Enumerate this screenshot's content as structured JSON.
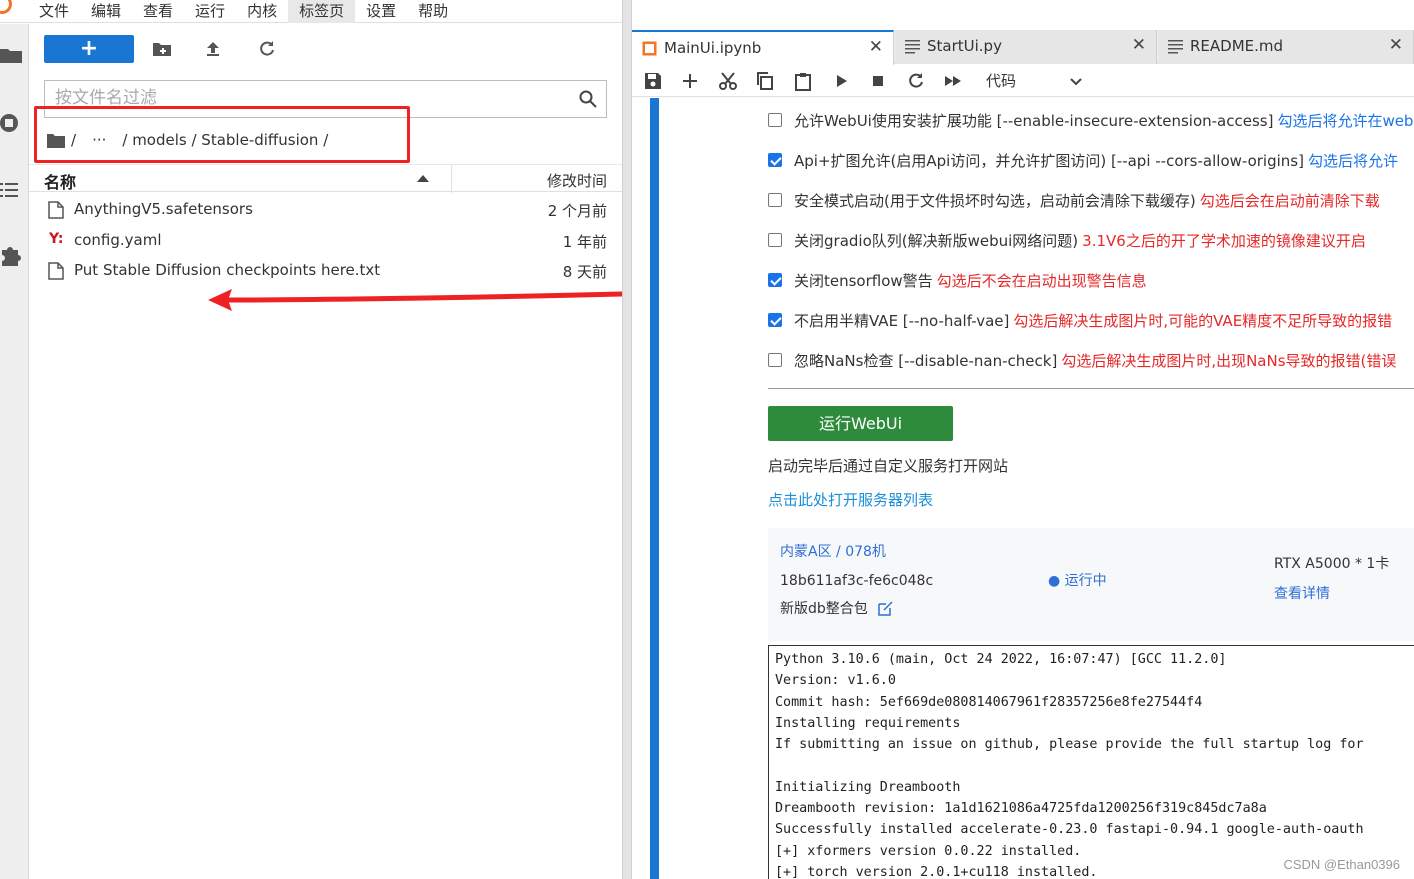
{
  "menubar": {
    "items": [
      {
        "label": "文件"
      },
      {
        "label": "编辑"
      },
      {
        "label": "查看"
      },
      {
        "label": "运行"
      },
      {
        "label": "内核"
      },
      {
        "label": "标签页"
      },
      {
        "label": "设置"
      },
      {
        "label": "帮助"
      }
    ]
  },
  "filebrowser": {
    "new_label": "+",
    "filter_placeholder": "按文件名过滤",
    "breadcrumb": {
      "root": "/",
      "ellipsis": "···",
      "path": "/ models / Stable-diffusion /"
    },
    "header": {
      "name": "名称",
      "modified": "修改时间"
    },
    "files": [
      {
        "name": "AnythingV5.safetensors",
        "modified": "2 个月前",
        "icon": "file-icon"
      },
      {
        "name": "config.yaml",
        "modified": "1 年前",
        "icon": "yaml-icon",
        "icon_text": "Y:"
      },
      {
        "name": "Put Stable Diffusion checkpoints here.txt",
        "modified": "8 天前",
        "icon": "file-icon"
      }
    ]
  },
  "tabs": [
    {
      "label": "MainUi.ipynb",
      "close": "✕",
      "icon": "notebook-icon"
    },
    {
      "label": "StartUi.py",
      "close": "✕",
      "icon": "text-file-icon"
    },
    {
      "label": "README.md",
      "close": "✕",
      "icon": "text-file-icon"
    }
  ],
  "nb_toolbar": {
    "cell_type": "代码"
  },
  "options": [
    {
      "checked": false,
      "text": "允许WebUi使用安装扩展功能 [--enable-insecure-extension-access]",
      "note": "勾选后将允许在web",
      "note_color": "blue"
    },
    {
      "checked": true,
      "text": "Api+扩图允许(启用Api访问，并允许扩图访问) [--api --cors-allow-origins]",
      "note": "勾选后将允许",
      "note_color": "blue"
    },
    {
      "checked": false,
      "text": "安全模式启动(用于文件损坏时勾选，启动前会清除下载缓存)",
      "note": "勾选后会在启动前清除下载",
      "note_color": "red"
    },
    {
      "checked": false,
      "text": "关闭gradio队列(解决新版webui网络问题)",
      "note": "3.1V6之后的开了学术加速的镜像建议开启",
      "note_color": "red"
    },
    {
      "checked": true,
      "text": "关闭tensorflow警告",
      "note": "勾选后不会在启动出现警告信息",
      "note_color": "red"
    },
    {
      "checked": true,
      "text": "不启用半精VAE [--no-half-vae]",
      "note": "勾选后解决生成图片时,可能的VAE精度不足所导致的报错",
      "note_color": "red"
    },
    {
      "checked": false,
      "text": "忽略NaNs检查 [--disable-nan-check]",
      "note": "勾选后解决生成图片时,出现NaNs导致的报错(错误",
      "note_color": "red"
    }
  ],
  "run_button": "运行WebUi",
  "after_run_text": "启动完毕后通过自定义服务打开网站",
  "server_list_link": "点击此处打开服务器列表",
  "server_card": {
    "region": "内蒙A区 / 078机",
    "instance_id": "18b611af3c-fe6c048c",
    "package": "新版db整合包",
    "status": "● 运行中",
    "gpu": "RTX A5000 * 1卡",
    "detail_link": "查看详情"
  },
  "console_lines": [
    "Python 3.10.6 (main, Oct 24 2022, 16:07:47) [GCC 11.2.0]",
    "Version: v1.6.0",
    "Commit hash: 5ef669de080814067961f28357256e8fe27544f4",
    "Installing requirements",
    "If submitting an issue on github, please provide the full startup log for",
    "",
    "Initializing Dreambooth",
    "Dreambooth revision: 1a1d1621086a4725fda1200256f319c845dc7a8a",
    "Successfully installed accelerate-0.23.0 fastapi-0.94.1 google-auth-oauth",
    "[+] xformers version 0.0.22 installed.",
    "[+] torch version 2.0.1+cu118 installed."
  ],
  "watermark": "CSDN @Ethan0396",
  "colors": {
    "accent": "#1976d2",
    "run_button": "#2e8b3c",
    "annotation_red": "#ee2222",
    "note_red": "#e62828",
    "note_blue": "#1a73e8"
  }
}
